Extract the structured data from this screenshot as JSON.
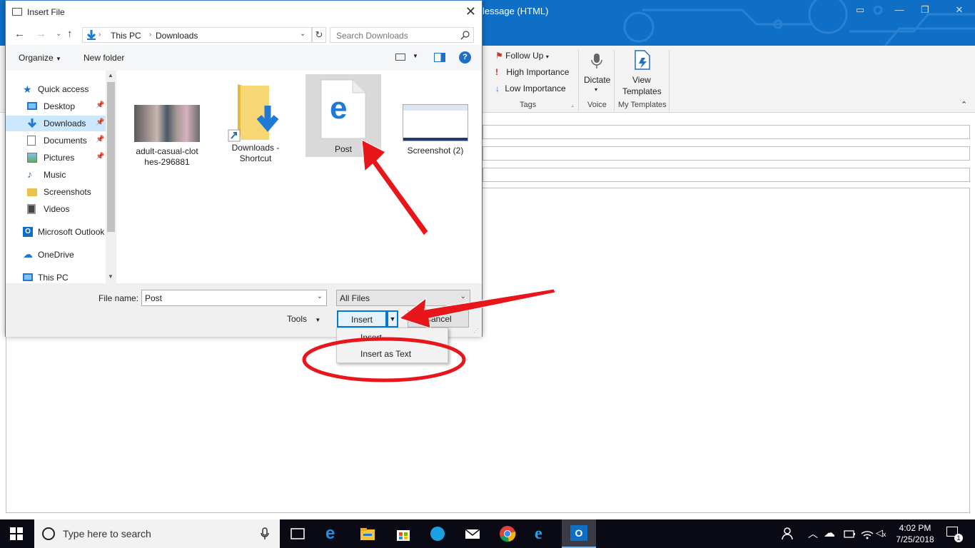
{
  "outlook": {
    "title_fragment": "lessage (HTML)",
    "ribbon": {
      "follow_up": "Follow Up",
      "high_importance": "High Importance",
      "low_importance": "Low Importance",
      "tags_group": "Tags",
      "dictate": "Dictate",
      "voice_group": "Voice",
      "view_templates_line1": "View",
      "view_templates_line2": "Templates",
      "my_templates_group": "My Templates"
    }
  },
  "dialog": {
    "title": "Insert File",
    "breadcrumb": [
      "This PC",
      "Downloads"
    ],
    "search_placeholder": "Search Downloads",
    "organize": "Organize",
    "new_folder": "New folder",
    "nav_items": [
      {
        "label": "Quick access",
        "icon": "star-icon"
      },
      {
        "label": "Desktop",
        "icon": "desktop-icon",
        "pinned": true
      },
      {
        "label": "Downloads",
        "icon": "download-icon",
        "pinned": true,
        "selected": true
      },
      {
        "label": "Documents",
        "icon": "documents-icon",
        "pinned": true
      },
      {
        "label": "Pictures",
        "icon": "pictures-icon",
        "pinned": true
      },
      {
        "label": "Music",
        "icon": "music-icon"
      },
      {
        "label": "Screenshots",
        "icon": "folder-icon"
      },
      {
        "label": "Videos",
        "icon": "videos-icon"
      },
      {
        "label": "Microsoft Outlook",
        "icon": "outlook-icon"
      },
      {
        "label": "OneDrive",
        "icon": "onedrive-icon"
      },
      {
        "label": "This PC",
        "icon": "pc-icon"
      }
    ],
    "files": [
      {
        "name": "adult-casual-clot hes-296881",
        "type": "image"
      },
      {
        "name": "Downloads - Shortcut",
        "type": "shortcut"
      },
      {
        "name": "Post",
        "type": "edge-html",
        "selected": true
      },
      {
        "name": "Screenshot (2)",
        "type": "image"
      }
    ],
    "file_name_label": "File name:",
    "file_name_value": "Post",
    "file_type": "All Files",
    "tools": "Tools",
    "insert": "Insert",
    "cancel": "Cancel",
    "menu": [
      "Insert",
      "Insert as Text"
    ]
  },
  "taskbar": {
    "search_placeholder": "Type here to search",
    "time": "4:02 PM",
    "date": "7/25/2018",
    "notification_count": "1"
  },
  "colors": {
    "outlook_blue": "#0f6fc6",
    "annotation_red": "#e8151b",
    "selection": "#cce8ff"
  }
}
